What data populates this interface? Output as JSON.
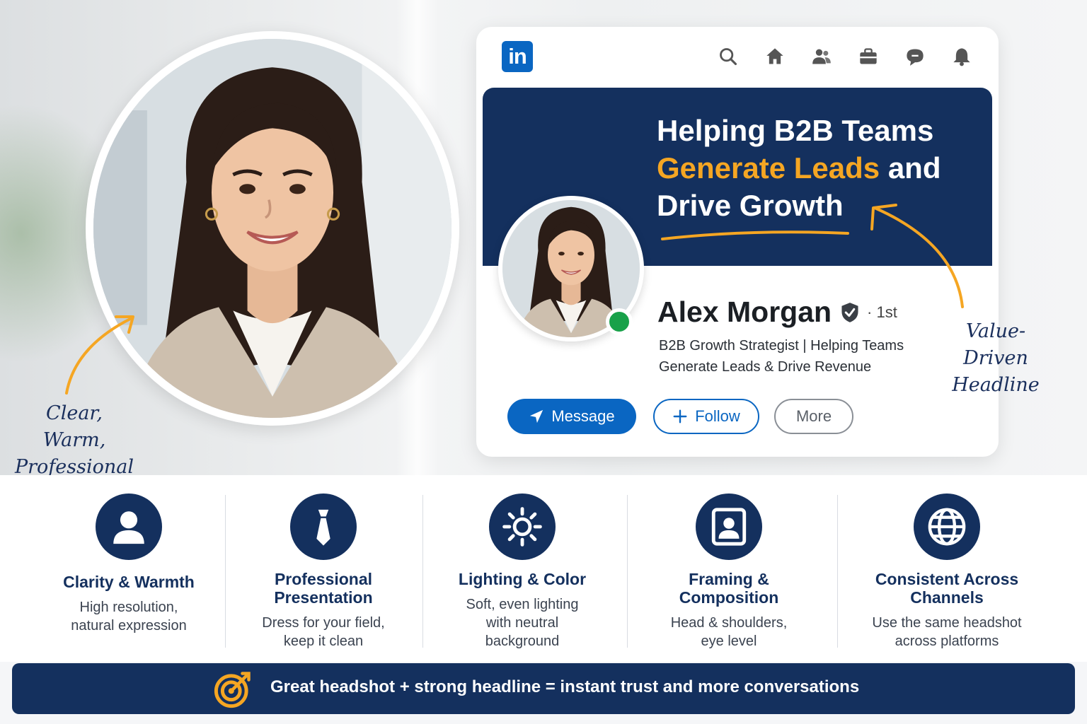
{
  "annotations": {
    "left": [
      "Clear, Warm,",
      "Professional"
    ],
    "right": [
      "Value-Driven",
      "Headline"
    ]
  },
  "profile_card": {
    "logo": "in",
    "nav_icons": [
      "search-icon",
      "home-icon",
      "network-icon",
      "jobs-icon",
      "messaging-icon",
      "notifications-icon"
    ],
    "banner": {
      "line1": "Helping B2B Teams",
      "line2_highlight": "Generate Leads",
      "line2_rest": " and",
      "line3": "Drive Growth"
    },
    "name": "Alex Morgan",
    "degree": "· 1st",
    "tagline_line1": "B2B Growth Strategist | Helping Teams",
    "tagline_line2": "Generate Leads & Drive Revenue",
    "buttons": {
      "message": "Message",
      "follow": "Follow",
      "more": "More"
    }
  },
  "features": [
    {
      "icon": "user-icon",
      "title": "Clarity & Warmth",
      "desc": [
        "High resolution,",
        "natural expression"
      ]
    },
    {
      "icon": "tie-icon",
      "title": "Professional Presentation",
      "desc": [
        "Dress for your field,",
        "keep it clean"
      ]
    },
    {
      "icon": "sun-icon",
      "title": "Lighting & Color",
      "desc": [
        "Soft, even lighting",
        "with neutral",
        "background"
      ]
    },
    {
      "icon": "portrait-frame-icon",
      "title": "Framing & Composition",
      "desc": [
        "Head & shoulders,",
        "eye level"
      ]
    },
    {
      "icon": "globe-icon",
      "title": "Consistent Across Channels",
      "desc": [
        "Use the same headshot",
        "across platforms"
      ]
    }
  ],
  "footer": {
    "icon": "target-icon",
    "text": "Great headshot + strong headline = instant trust and more conversations"
  },
  "colors": {
    "navy": "#14305e",
    "linkedin_blue": "#0a66c2",
    "accent_orange": "#f5a623",
    "online_green": "#18a149"
  }
}
